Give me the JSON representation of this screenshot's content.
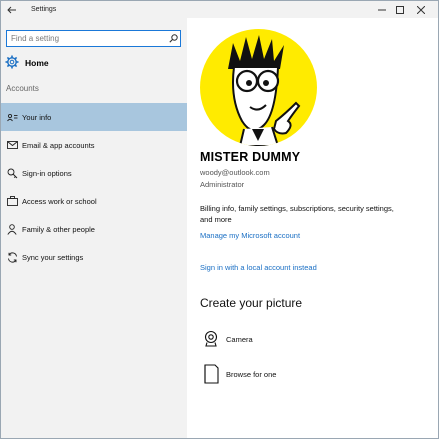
{
  "window": {
    "title": "Settings",
    "back_icon": "back-arrow-icon",
    "minimize_icon": "minimize-icon",
    "maximize_icon": "maximize-icon",
    "close_icon": "close-icon"
  },
  "sidebar": {
    "search": {
      "placeholder": "Find a setting",
      "value": ""
    },
    "home_label": "Home",
    "section_label": "Accounts",
    "items": [
      {
        "label": "Your info",
        "icon": "id-card-icon",
        "active": true
      },
      {
        "label": "Email & app accounts",
        "icon": "envelope-icon",
        "active": false
      },
      {
        "label": "Sign-in options",
        "icon": "key-icon",
        "active": false
      },
      {
        "label": "Access work or school",
        "icon": "briefcase-icon",
        "active": false
      },
      {
        "label": "Family & other people",
        "icon": "person-icon",
        "active": false
      },
      {
        "label": "Sync your settings",
        "icon": "sync-icon",
        "active": false
      }
    ]
  },
  "profile": {
    "name": "MISTER DUMMY",
    "email": "woody@outlook.com",
    "role": "Administrator",
    "billing_text": "Billing info, family settings, subscriptions, security settings, and more",
    "manage_link": "Manage my Microsoft account",
    "local_link": "Sign in with a local account instead"
  },
  "picture": {
    "heading": "Create your picture",
    "options": [
      {
        "label": "Camera",
        "icon": "camera-icon"
      },
      {
        "label": "Browse for one",
        "icon": "browse-icon"
      }
    ]
  },
  "colors": {
    "accent": "#1a6fc4",
    "active_nav": "#a8c6de",
    "sidebar_bg": "#f2f2f2",
    "avatar_bg": "#ffeb00"
  }
}
